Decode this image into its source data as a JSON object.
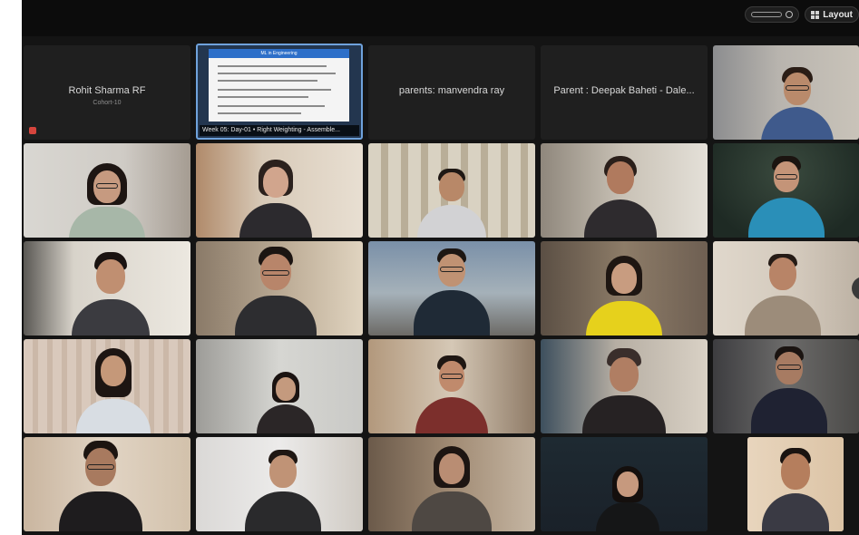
{
  "topbar": {
    "view_label": "Layout"
  },
  "tiles": [
    {
      "type": "name",
      "name": "Rohit Sharma RF",
      "subtitle": "Cohort-10",
      "muted": true
    },
    {
      "type": "share",
      "slide_title": "ML in Engineering",
      "caption": "Week 05: Day-01 • Right Weighting - Assemble..."
    },
    {
      "type": "name",
      "name": "parents: manvendra ray",
      "subtitle": "",
      "muted": false
    },
    {
      "type": "name",
      "name": "Parent : Deepak Baheti - Dale...",
      "subtitle": "",
      "muted": false
    },
    {
      "type": "video"
    },
    {
      "type": "video"
    },
    {
      "type": "video"
    },
    {
      "type": "video"
    },
    {
      "type": "video"
    },
    {
      "type": "video"
    },
    {
      "type": "video"
    },
    {
      "type": "video"
    },
    {
      "type": "video"
    },
    {
      "type": "video"
    },
    {
      "type": "video"
    },
    {
      "type": "video"
    },
    {
      "type": "video"
    },
    {
      "type": "video"
    },
    {
      "type": "video"
    },
    {
      "type": "video"
    },
    {
      "type": "video"
    },
    {
      "type": "video"
    },
    {
      "type": "video"
    },
    {
      "type": "video"
    },
    {
      "type": "video"
    }
  ],
  "colors": {
    "background": "#141414",
    "share_border": "#6fa2dc",
    "slide_header": "#2d6fc9",
    "muted": "#d6453d"
  },
  "icons": {
    "muted": "mic-muted-icon",
    "gallery": "grid-icon"
  }
}
